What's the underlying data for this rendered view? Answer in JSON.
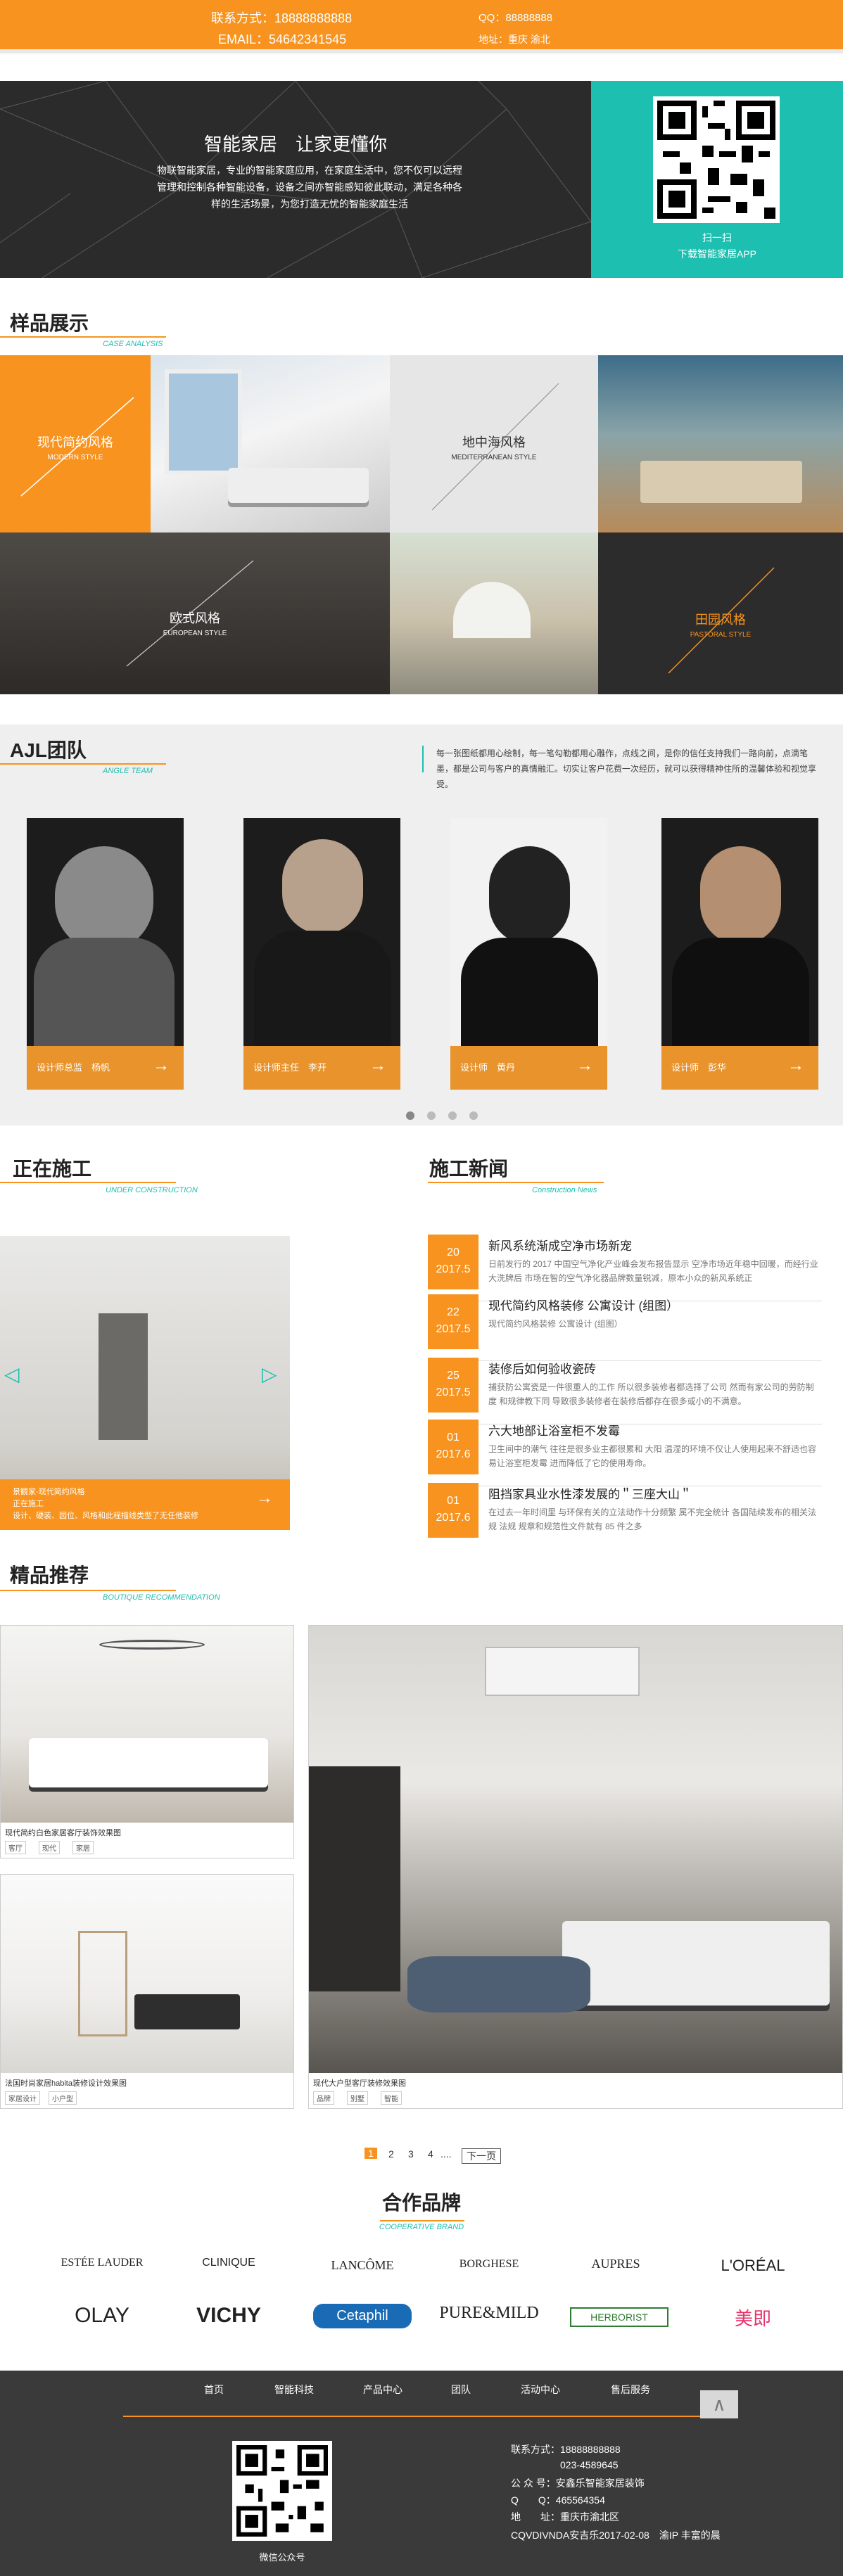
{
  "topbar": {
    "phone": "联系方式：18888888888",
    "email": "EMAIL：54642341545",
    "qq": "QQ：88888888",
    "address": "地址：重庆 渝北"
  },
  "hero": {
    "title": "智能家居　让家更懂你",
    "desc": "物联智能家居，专业的智能家庭应用，在家庭生活中，您不仅可以远程管理和控制各种智能设备，设备之间亦智能感知彼此联动，满足各种各样的生活场景，为您打造无忧的智能家庭生活",
    "qr_caption1": "扫一扫",
    "qr_caption2": "下载智能家居APP"
  },
  "cases": {
    "title": "样品展示",
    "subtitle": "CASE ANALYSIS",
    "items": [
      {
        "cn": "现代简约风格",
        "en": "MODERN STYLE"
      },
      {
        "cn": "地中海风格",
        "en": "MEDITERRANEAN STYLE"
      },
      {
        "cn": "欧式风格",
        "en": "EUROPEAN STYLE"
      },
      {
        "cn": "田园风格",
        "en": "PASTORAL STYLE"
      }
    ]
  },
  "team": {
    "title": "AJL团队",
    "subtitle": "ANGLE TEAM",
    "desc": "每一张图纸都用心绘制，每一笔勾勒都用心雕作，点线之间，是你的信任支持我们一路向前，点滴笔墨，都是公司与客户的真情融汇。切实让客户花费一次经历，就可以获得精神住所的温馨体验和视觉享受。",
    "members": [
      {
        "label": "设计师总监　杨帆"
      },
      {
        "label": "设计师主任　李开"
      },
      {
        "label": "设计师　黄丹"
      },
      {
        "label": "设计师　彭华"
      }
    ]
  },
  "construction": {
    "title": "正在施工",
    "subtitle": "UNDER CONSTRUCTION",
    "caption1": "景観家-现代简约风格",
    "caption2": "正在施工",
    "caption3": "设计、硬装、园位、风格和此程描线类型了无任他装修"
  },
  "news": {
    "title": "施工新闻",
    "subtitle": "Construction News",
    "items": [
      {
        "day": "20",
        "month": "2017.5",
        "title": "新风系统渐成空净市场新宠",
        "desc": "日前发行的 2017 中国空气净化产业峰会发布报告显示 空净市场近年稳中回暖，而经行业大洗牌后 市场在智的空气净化器品牌数量锐减，原本小众的新风系统正"
      },
      {
        "day": "22",
        "month": "2017.5",
        "title": "现代简约风格装修 公寓设计 (组图）",
        "desc": "现代简约风格装修 公寓设计 (组图）"
      },
      {
        "day": "25",
        "month": "2017.5",
        "title": "装修后如何验收瓷砖",
        "desc": "捕获防公寓瓷是一件很重人的工作 所以很多装修者都选择了公司 然而有家公司的劳防制度 和规律教下同 导致很多装修者在装修后都存在很多或小的不满意。"
      },
      {
        "day": "01",
        "month": "2017.6",
        "title": "六大地部让浴室柜不发霉",
        "desc": "卫生间中的潮气 往往是很多业主都很累和 大阳 温湿的环境不仅让人使用起来不舒适也容易让浴室柜发霉 进而降低了它的使用寿命。"
      },
      {
        "day": "01",
        "month": "2017.6",
        "title": "阻挡家具业水性漆发展的＂三座大山＂",
        "desc": "在过去一年时间里 与环保有关的立法动作十分频繁 属不完全统计 各国陆续发布的相关法规 法规 规章和规范性文件就有 85 件之多"
      }
    ]
  },
  "products": {
    "title": "精品推荐",
    "subtitle": "BOUTIQUE RECOMMENDATION",
    "items": [
      {
        "caption": "现代简约白色家居客厅装饰效果图",
        "tags": [
          "客厅",
          "现代",
          "家居"
        ]
      },
      {
        "caption": "法国时尚家居habita装修设计效果图",
        "tags": [
          "家居设计",
          "小户型"
        ]
      },
      {
        "caption": "现代大户型客厅装修效果图",
        "tags": [
          "品牌",
          "别墅",
          "智能"
        ]
      }
    ]
  },
  "pagination": {
    "pages": [
      "1",
      "2",
      "3",
      "4"
    ],
    "ellipsis": "....",
    "next": "下一页"
  },
  "partners": {
    "title": "合作品牌",
    "subtitle": "COOPERATIVE BRAND",
    "brands": [
      "ESTÉE LAUDER",
      "CLINIQUE",
      "LANCÔME",
      "BORGHESE",
      "AUPRES",
      "L'ORÉAL",
      "OLAY",
      "VICHY",
      "Cetaphil",
      "PURE&MILD",
      "HERBORIST",
      "美即"
    ]
  },
  "footer": {
    "nav": [
      "首页",
      "智能科技",
      "产品中心",
      "团队",
      "活动中心",
      "售后服务"
    ],
    "qr_caption": "微信公众号",
    "contact": "联系方式：18888888888",
    "phone2": "023-4589645",
    "wechat": "公 众 号：安鑫乐智能家居装饰",
    "qq": "Q　　Q：465564354",
    "address": "地　　址：重庆市渝北区",
    "copyright": "CQVDIVNDA安吉乐2017-02-08　渝IP 丰富的晨"
  },
  "colors": {
    "accent": "#f7931e",
    "teal": "#1dbfb0",
    "footer": "#3a3a3a"
  }
}
